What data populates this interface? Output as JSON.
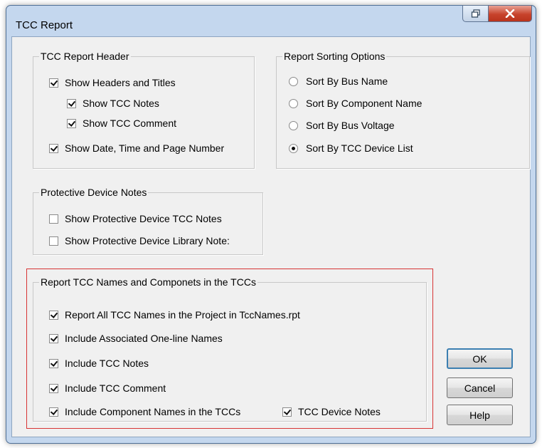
{
  "window": {
    "title": "TCC Report"
  },
  "header_group": {
    "title": "TCC Report Header",
    "items": [
      {
        "label": "Show Headers and Titles",
        "checked": true
      },
      {
        "label": "Show TCC Notes",
        "checked": true
      },
      {
        "label": "Show TCC Comment",
        "checked": true
      },
      {
        "label": "Show Date, Time and Page Number",
        "checked": true
      }
    ]
  },
  "sorting_group": {
    "title": "Report Sorting Options",
    "options": [
      {
        "label": "Sort By Bus Name",
        "selected": false
      },
      {
        "label": "Sort By Component Name",
        "selected": false
      },
      {
        "label": "Sort By Bus Voltage",
        "selected": false
      },
      {
        "label": "Sort By TCC Device List",
        "selected": true
      }
    ]
  },
  "notes_group": {
    "title": "Protective Device Notes",
    "items": [
      {
        "label": "Show Protective Device TCC Notes",
        "checked": false
      },
      {
        "label": "Show Protective Device Library Note:",
        "checked": false
      }
    ]
  },
  "names_group": {
    "title": "Report TCC Names and Componets in the TCCs",
    "items": [
      {
        "label": "Report All TCC Names in the Project in TccNames.rpt",
        "checked": true
      },
      {
        "label": "Include Associated One-line Names",
        "checked": true
      },
      {
        "label": "Include TCC Notes",
        "checked": true
      },
      {
        "label": "Include TCC Comment",
        "checked": true
      },
      {
        "label": "Include Component Names in the TCCs",
        "checked": true
      },
      {
        "label": "TCC Device Notes",
        "checked": true
      }
    ]
  },
  "buttons": {
    "ok": "OK",
    "cancel": "Cancel",
    "help": "Help"
  },
  "colors": {
    "highlight_frame": "#d83434",
    "title_bar": "#c4d7ee",
    "close_button": "#c7432c"
  }
}
